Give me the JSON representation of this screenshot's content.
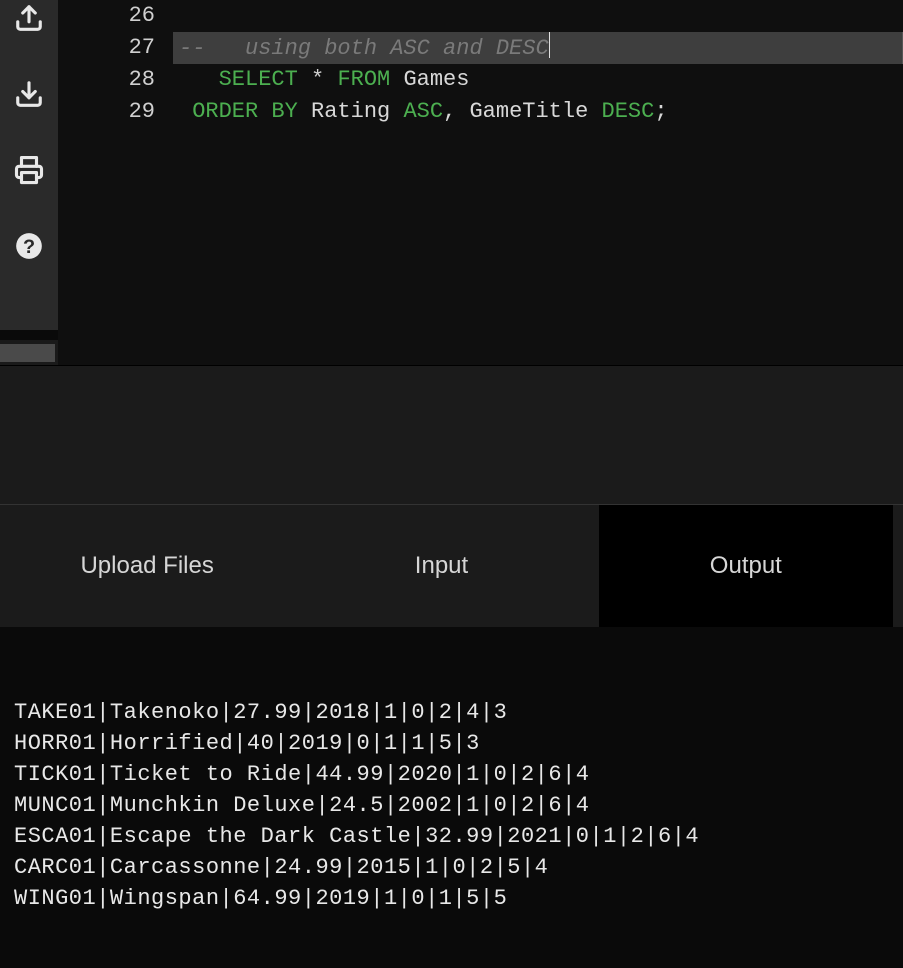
{
  "editor": {
    "lines": [
      {
        "num": "26",
        "tokens": []
      },
      {
        "num": "27",
        "highlight": true,
        "tokens": [
          {
            "cls": "tok-comment",
            "text": "--   using both ASC and DESC"
          }
        ],
        "cursorAfter": true
      },
      {
        "num": "28",
        "tokens": [
          {
            "cls": "tok-op",
            "text": "   "
          },
          {
            "cls": "tok-kw",
            "text": "SELECT"
          },
          {
            "cls": "tok-op",
            "text": " "
          },
          {
            "cls": "tok-op",
            "text": "*"
          },
          {
            "cls": "tok-op",
            "text": " "
          },
          {
            "cls": "tok-kw",
            "text": "FROM"
          },
          {
            "cls": "tok-op",
            "text": " "
          },
          {
            "cls": "tok-id",
            "text": "Games"
          }
        ]
      },
      {
        "num": "29",
        "tokens": [
          {
            "cls": "tok-op",
            "text": " "
          },
          {
            "cls": "tok-kw",
            "text": "ORDER BY"
          },
          {
            "cls": "tok-op",
            "text": " "
          },
          {
            "cls": "tok-id",
            "text": "Rating"
          },
          {
            "cls": "tok-op",
            "text": " "
          },
          {
            "cls": "tok-kw",
            "text": "ASC"
          },
          {
            "cls": "tok-punc",
            "text": ","
          },
          {
            "cls": "tok-op",
            "text": " "
          },
          {
            "cls": "tok-id",
            "text": "GameTitle"
          },
          {
            "cls": "tok-op",
            "text": " "
          },
          {
            "cls": "tok-kw",
            "text": "DESC"
          },
          {
            "cls": "tok-punc",
            "text": ";"
          }
        ]
      }
    ]
  },
  "tabs": {
    "upload": "Upload Files",
    "input": "Input",
    "output": "Output",
    "active": "output"
  },
  "output": {
    "rows": [
      "TAKE01|Takenoko|27.99|2018|1|0|2|4|3",
      "HORR01|Horrified|40|2019|0|1|1|5|3",
      "TICK01|Ticket to Ride|44.99|2020|1|0|2|6|4",
      "MUNC01|Munchkin Deluxe|24.5|2002|1|0|2|6|4",
      "ESCA01|Escape the Dark Castle|32.99|2021|0|1|2|6|4",
      "CARC01|Carcassonne|24.99|2015|1|0|2|5|4",
      "WING01|Wingspan|64.99|2019|1|0|1|5|5"
    ]
  },
  "sidebar": {
    "icons": [
      "upload-icon",
      "download-icon",
      "print-icon",
      "help-icon"
    ]
  }
}
